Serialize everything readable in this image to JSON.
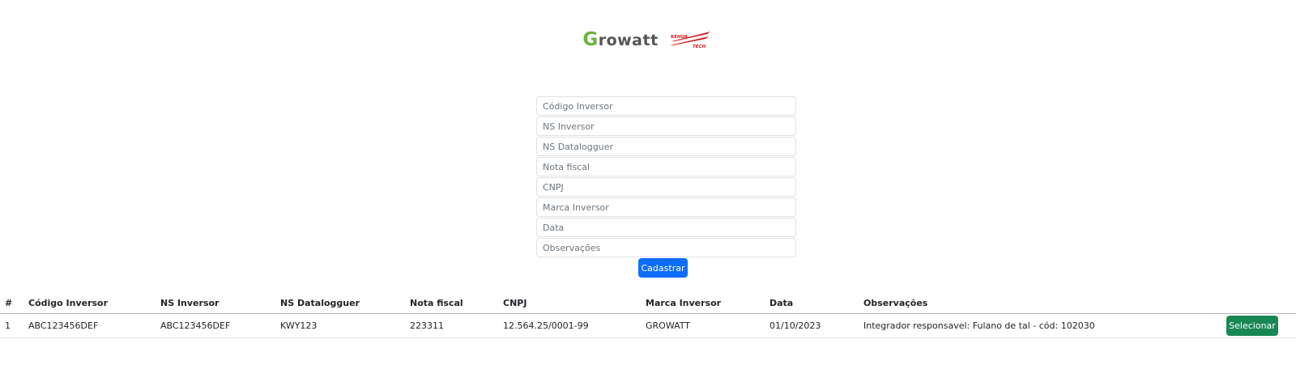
{
  "header": {
    "growatt_logo_first": "G",
    "growatt_logo_rest": "rowatt",
    "kehua_logo_text": "KEHUA TECH"
  },
  "form": {
    "fields": [
      {
        "placeholder": "Código Inversor",
        "value": ""
      },
      {
        "placeholder": "NS Inversor",
        "value": ""
      },
      {
        "placeholder": "NS Datalogguer",
        "value": ""
      },
      {
        "placeholder": "Nota fiscal",
        "value": ""
      },
      {
        "placeholder": "CNPJ",
        "value": ""
      },
      {
        "placeholder": "Marca Inversor",
        "value": ""
      },
      {
        "placeholder": "Data",
        "value": ""
      },
      {
        "placeholder": "Observações",
        "value": ""
      }
    ],
    "submit_label": "Cadastrar"
  },
  "table": {
    "headers": [
      "#",
      "Código Inversor",
      "NS Inversor",
      "NS Datalogguer",
      "Nota fiscal",
      "CNPJ",
      "Marca Inversor",
      "Data",
      "Observações",
      ""
    ],
    "rows": [
      {
        "cells": [
          "1",
          "ABC123456DEF",
          "ABC123456DEF",
          "KWY123",
          "223311",
          "12.564.25/0001-99",
          "GROWATT",
          "01/10/2023",
          "Integrador responsavel: Fulano de tal - cód: 102030"
        ],
        "action_label": "Selecionar"
      }
    ]
  },
  "colors": {
    "primary": "#0d6efd",
    "success": "#198754",
    "growatt_green": "#6db33f",
    "kehua_red": "#d7191f"
  }
}
